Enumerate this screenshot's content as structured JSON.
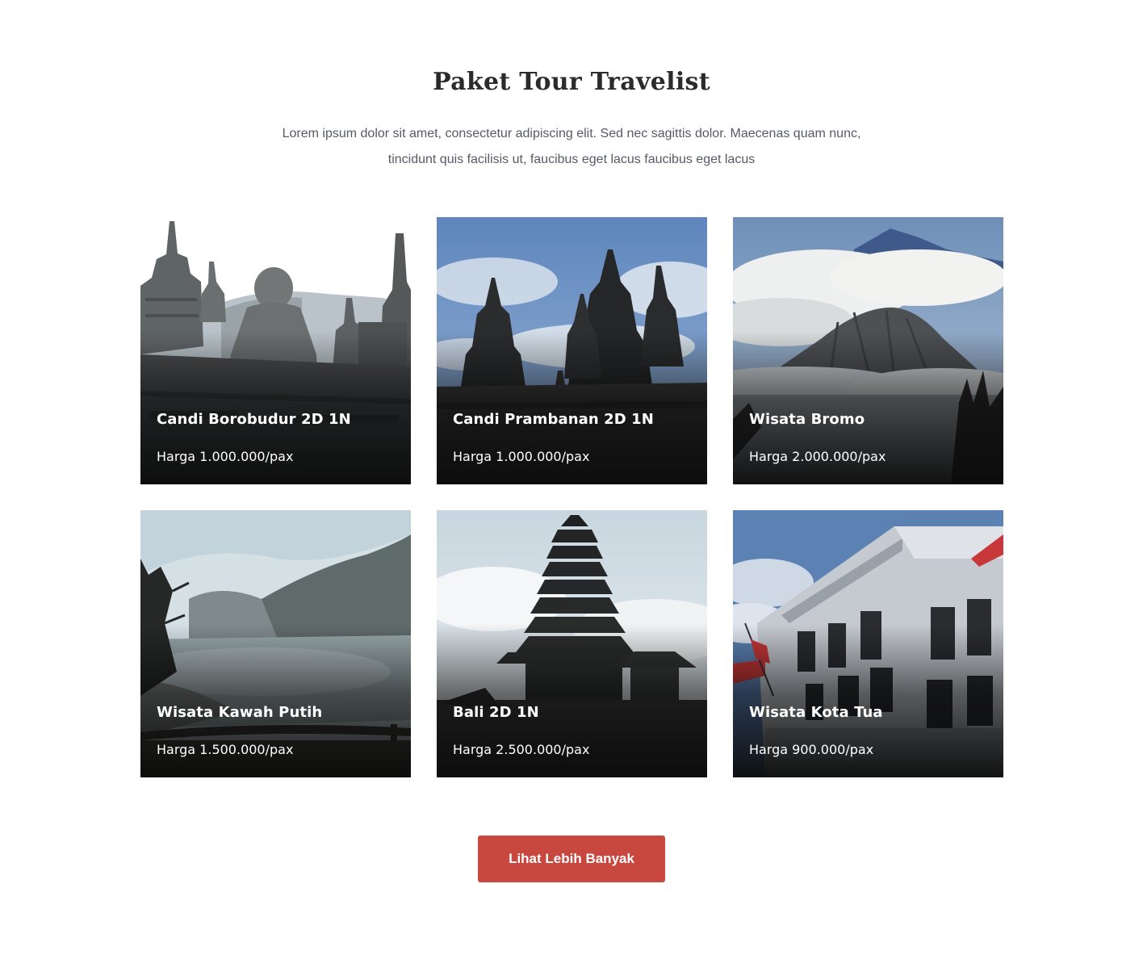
{
  "section": {
    "title": "Paket Tour Travelist",
    "description_line1": "Lorem ipsum dolor sit amet, consectetur adipiscing elit. Sed nec sagittis dolor. Maecenas quam nunc,",
    "description_line2": "tincidunt quis facilisis ut, faucibus eget lacus faucibus eget lacus"
  },
  "tours": [
    {
      "title": "Candi Borobudur 2D 1N",
      "price": "Harga 1.000.000/pax",
      "image": "borobudur-photo"
    },
    {
      "title": "Candi Prambanan 2D 1N",
      "price": "Harga 1.000.000/pax",
      "image": "prambanan-photo"
    },
    {
      "title": "Wisata Bromo",
      "price": "Harga 2.000.000/pax",
      "image": "bromo-photo"
    },
    {
      "title": "Wisata Kawah Putih",
      "price": "Harga 1.500.000/pax",
      "image": "kawah-putih-photo"
    },
    {
      "title": "Bali 2D 1N",
      "price": "Harga 2.500.000/pax",
      "image": "bali-temple-photo"
    },
    {
      "title": "Wisata Kota Tua",
      "price": "Harga 900.000/pax",
      "image": "kota-tua-photo"
    }
  ],
  "cta": {
    "label": "Lihat Lebih Banyak"
  },
  "colors": {
    "accent": "#c8473e",
    "title": "#2b2b2b",
    "body_text": "#555b66"
  }
}
